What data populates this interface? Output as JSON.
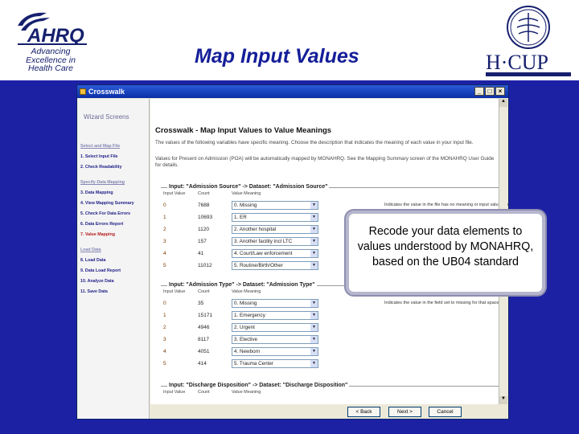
{
  "header": {
    "ahrq_tagline": [
      "Advancing",
      "Excellence in",
      "Health Care"
    ],
    "slide_title": "Map Input Values"
  },
  "dialog": {
    "title": "Crosswalk",
    "wizard_heading": "Wizard Screens",
    "steps": [
      {
        "label": "Select and Map File",
        "kind": "section"
      },
      {
        "label": "1. Select Input File",
        "kind": "step"
      },
      {
        "label": "2. Check Readability",
        "kind": "step"
      },
      {
        "label": "Specify Data Mapping",
        "kind": "section"
      },
      {
        "label": "3. Data Mapping",
        "kind": "step"
      },
      {
        "label": "4. View Mapping Summary",
        "kind": "step"
      },
      {
        "label": "5. Check For Data Errors",
        "kind": "step"
      },
      {
        "label": "6. Data Errors Report",
        "kind": "step"
      },
      {
        "label": "7. Value Mapping",
        "kind": "active"
      },
      {
        "label": "Load Data",
        "kind": "section"
      },
      {
        "label": "8. Load Data",
        "kind": "step"
      },
      {
        "label": "9. Data Load Report",
        "kind": "step"
      },
      {
        "label": "10. Analyze Data",
        "kind": "step"
      },
      {
        "label": "11. Save Data",
        "kind": "step"
      }
    ],
    "content_heading": "Crosswalk - Map Input Values to Value Meanings",
    "para1": "The values of the following variables have specific meaning. Choose the description that indicates the meaning of each value in your input file.",
    "para2": "Values for Present on Admission (POA) will be automatically mapped by MONAHRQ. See the Mapping Summary screen of the MONAHRQ User Guide for details.",
    "col_input_value": "Input Value",
    "col_count": "Count",
    "col_meaning": "Value Meaning",
    "groups": [
      {
        "title": "Input: \"Admission Source\" -> Dataset: \"Admission Source\"",
        "hint": "Indicates the value in the file has no meaning or input value range",
        "rows": [
          {
            "value": "0",
            "count": "7688",
            "meaning": "0. Missing"
          },
          {
            "value": "1",
            "count": "10693",
            "meaning": "1. ER"
          },
          {
            "value": "2",
            "count": "1120",
            "meaning": "2. Another hospital"
          },
          {
            "value": "3",
            "count": "157",
            "meaning": "3. Another facility incl LTC"
          },
          {
            "value": "4",
            "count": "41",
            "meaning": "4. Court/Law enforcement"
          },
          {
            "value": "5",
            "count": "11012",
            "meaning": "5. Routine/Birth/Other"
          }
        ]
      },
      {
        "title": "Input: \"Admission Type\" -> Dataset: \"Admission Type\"",
        "hint": "Indicates the value in the field set to missing for that space",
        "rows": [
          {
            "value": "0",
            "count": "35",
            "meaning": "0. Missing"
          },
          {
            "value": "1",
            "count": "15171",
            "meaning": "1. Emergency"
          },
          {
            "value": "2",
            "count": "4946",
            "meaning": "2. Urgent"
          },
          {
            "value": "3",
            "count": "8117",
            "meaning": "3. Elective"
          },
          {
            "value": "4",
            "count": "4051",
            "meaning": "4. Newborn"
          },
          {
            "value": "5",
            "count": "414",
            "meaning": "5. Trauma Center"
          }
        ]
      },
      {
        "title": "Input: \"Discharge Disposition\" -> Dataset: \"Discharge Disposition\"",
        "hint": "",
        "rows": []
      }
    ],
    "buttons": {
      "back": "< Back",
      "next": "Next >",
      "cancel": "Cancel"
    }
  },
  "callout": "Recode your data elements to values understood by MONAHRQ, based on the UB04 standard"
}
